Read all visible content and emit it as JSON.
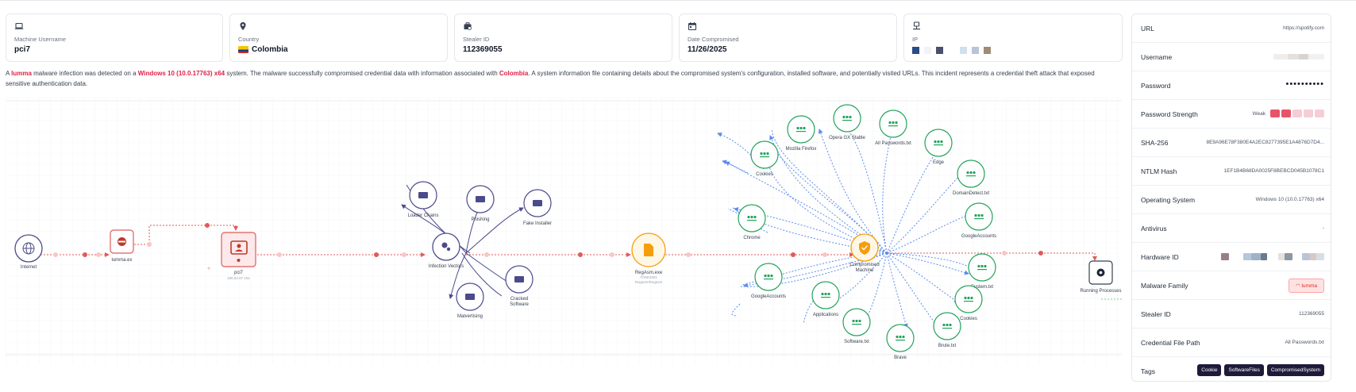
{
  "cards": [
    {
      "label": "Machine Username",
      "value": "pci7",
      "icon": "laptop-icon"
    },
    {
      "label": "Country",
      "value": "Colombia",
      "icon": "location-pin-icon"
    },
    {
      "label": "Stealer ID",
      "value": "112369055",
      "icon": "briefcase-icon"
    },
    {
      "label": "Date Compromised",
      "value": "11/26/2025",
      "icon": "calendar-icon"
    },
    {
      "label": "IP",
      "value": "",
      "icon": "network-pc-icon"
    }
  ],
  "description": {
    "p1": "A ",
    "malware": "lumma",
    "p2": " malware infection was detected on a ",
    "os": "Windows 10 (10.0.17763) x64",
    "p3": " system. The malware successfully compromised credential data with information associated with ",
    "country": "Colombia",
    "p4": ". A system information file containing details about the compromised system's configuration, installed software, and potentially visited URLs. This incident represents a credential theft attack that exposed sensitive authentication data."
  },
  "graph": {
    "internet": "Internet",
    "lumma": "lumma.ex",
    "host": "pci7",
    "host_sub": "186.82.87.161",
    "vectors": "Infection Vectors",
    "loader": "Loader Chains",
    "phishing": "Phishing",
    "fake": "Fake Installer",
    "cracked1": "Cracked",
    "cracked2": "Software",
    "malvert": "Malvertising",
    "regasm": "RegAsm.exe",
    "regasm_sub1": "7ONE4081",
    "regasm_sub2": "Regasm/Regasm",
    "comp1": "Compromised",
    "comp2": "Machine",
    "running": "Running Processes",
    "leaves": {
      "cookies1": "Cookies",
      "firefox": "Mozilla Firefox",
      "opera": "Opera GX Stable",
      "allpw": "All Passwords.txt",
      "edge": "Edge",
      "domain": "DomainDetect.txt",
      "gacc1": "GoogleAccounts",
      "chrome": "Chrome",
      "system": "System.txt",
      "cookies2": "Cookies",
      "brute": "Brute.txt",
      "brave": "Brave",
      "software": "Software.txt",
      "apps": "Applications",
      "gacc2": "GoogleAccounts"
    }
  },
  "panel": {
    "url": {
      "k": "URL",
      "v": "https://spotify.com"
    },
    "username": {
      "k": "Username",
      "v": ""
    },
    "password": {
      "k": "Password",
      "v": "••••••••••"
    },
    "strength": {
      "k": "Password Strength",
      "v": "Weak"
    },
    "sha": {
      "k": "SHA-256",
      "v": "8E9A96E78F380E4A2EC8277395E1A4876D7D4..."
    },
    "ntlm": {
      "k": "NTLM Hash",
      "v": "1EF1B4B68DA0025F8BEBCD045B1078C1"
    },
    "os": {
      "k": "Operating System",
      "v": "Windows 10 (10.0.17763) x64"
    },
    "av": {
      "k": "Antivirus",
      "v": "-"
    },
    "hwid": {
      "k": "Hardware ID",
      "v": ""
    },
    "family": {
      "k": "Malware Family",
      "v": "lumma"
    },
    "stealer": {
      "k": "Stealer ID",
      "v": "112369055"
    },
    "credpath": {
      "k": "Credential File Path",
      "v": "All Passwords.txt"
    },
    "tags": {
      "k": "Tags",
      "items": [
        "Cookie",
        "SoftwareFiles",
        "CompromisedSystem"
      ]
    }
  },
  "colors": {
    "accent_red": "#e11d48",
    "leaf_green": "#22a35a",
    "edge_blue": "#5b8def",
    "vector_purple": "#4b4a8c",
    "orange": "#f59e0b"
  }
}
